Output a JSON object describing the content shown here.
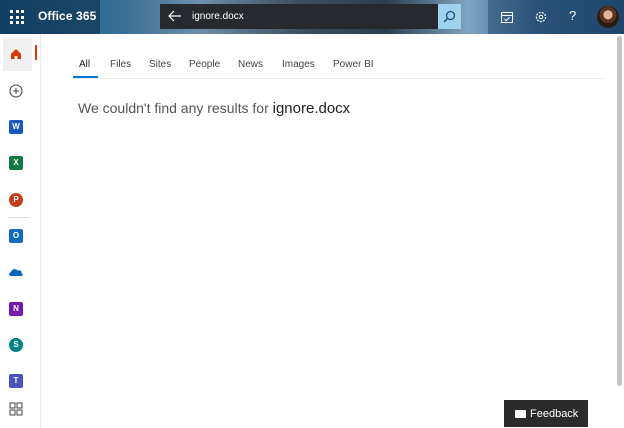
{
  "header": {
    "app_title": "Office 365",
    "search_value": "ignore.docx",
    "help_label": "?"
  },
  "rail": {
    "items": [
      {
        "name": "Home",
        "icon": "home-icon",
        "color": "#d83b01"
      },
      {
        "name": "Create",
        "icon": "add-circle-icon",
        "color": "#444444"
      },
      {
        "name": "Word",
        "icon": "word-icon",
        "color": "#185abd",
        "letter": "W"
      },
      {
        "name": "Excel",
        "icon": "excel-icon",
        "color": "#107c41",
        "letter": "X"
      },
      {
        "name": "PowerPoint",
        "icon": "powerpoint-icon",
        "color": "#c43e1c",
        "letter": "P"
      },
      {
        "name": "Outlook",
        "icon": "outlook-icon",
        "color": "#0f6cbd",
        "letter": "O"
      },
      {
        "name": "OneDrive",
        "icon": "onedrive-icon",
        "color": "#0364b8"
      },
      {
        "name": "OneNote",
        "icon": "onenote-icon",
        "color": "#7719aa",
        "letter": "N"
      },
      {
        "name": "SharePoint",
        "icon": "sharepoint-icon",
        "color": "#038387",
        "letter": "S"
      },
      {
        "name": "Teams",
        "icon": "teams-icon",
        "color": "#4b53bc",
        "letter": "T"
      },
      {
        "name": "All apps",
        "icon": "apps-icon",
        "color": "#444444"
      }
    ]
  },
  "tabs": [
    "All",
    "Files",
    "Sites",
    "People",
    "News",
    "Images",
    "Power BI"
  ],
  "selected_tab": "All",
  "results": {
    "message": "We couldn't find any results for",
    "query": "ignore.docx"
  },
  "feedback_label": "Feedback",
  "colors": {
    "accent": "#0078d4",
    "active_rail": "#d83b01",
    "search_button": "#9fd2ef"
  }
}
